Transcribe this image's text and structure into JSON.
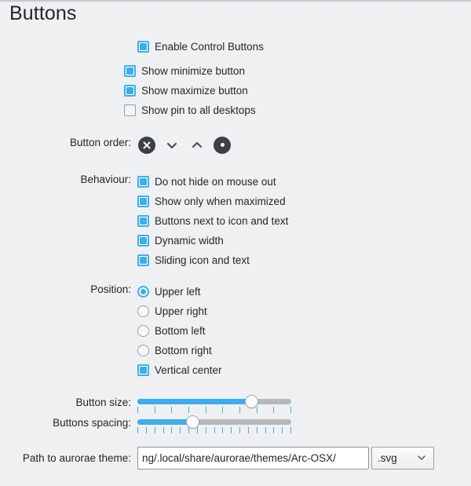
{
  "page": {
    "title": "Buttons",
    "background": "#eff0f1",
    "accent": "#3daee9",
    "text_color": "#232629"
  },
  "enable": {
    "label": "Enable Control Buttons",
    "state": "on"
  },
  "visibility": {
    "items": [
      {
        "label": "Show minimize button",
        "state": "on"
      },
      {
        "label": "Show maximize button",
        "state": "on"
      },
      {
        "label": "Show pin to all desktops",
        "state": "off"
      }
    ]
  },
  "button_order": {
    "label": "Button order:",
    "icons": [
      {
        "name": "close-icon",
        "glyph": "x-circle"
      },
      {
        "name": "minimize-icon",
        "glyph": "chevron-down"
      },
      {
        "name": "maximize-icon",
        "glyph": "chevron-up"
      },
      {
        "name": "all-desktops-icon",
        "glyph": "dot-circle"
      }
    ]
  },
  "behaviour": {
    "label": "Behaviour:",
    "items": [
      {
        "label": "Do not hide on mouse out",
        "state": "on"
      },
      {
        "label": "Show only when maximized",
        "state": "on"
      },
      {
        "label": "Buttons next to icon and text",
        "state": "on"
      },
      {
        "label": "Dynamic width",
        "state": "on"
      },
      {
        "label": "Sliding icon and text",
        "state": "on"
      }
    ]
  },
  "position": {
    "label": "Position:",
    "radios": [
      {
        "label": "Upper left",
        "state": "on"
      },
      {
        "label": "Upper right",
        "state": "off"
      },
      {
        "label": "Bottom left",
        "state": "off"
      },
      {
        "label": "Bottom right",
        "state": "off"
      }
    ],
    "vertical_center": {
      "label": "Vertical center",
      "state": "on"
    }
  },
  "sliders": [
    {
      "label": "Button size:",
      "fill_percent": 74,
      "tick_count": 10
    },
    {
      "label": "Buttons spacing:",
      "fill_percent": 36,
      "tick_count": 19
    }
  ],
  "path": {
    "label": "Path to aurorae theme:",
    "value": "ng/.local/share/aurorae/themes/Arc-OSX/",
    "placeholder": "",
    "extension": ".svg"
  }
}
